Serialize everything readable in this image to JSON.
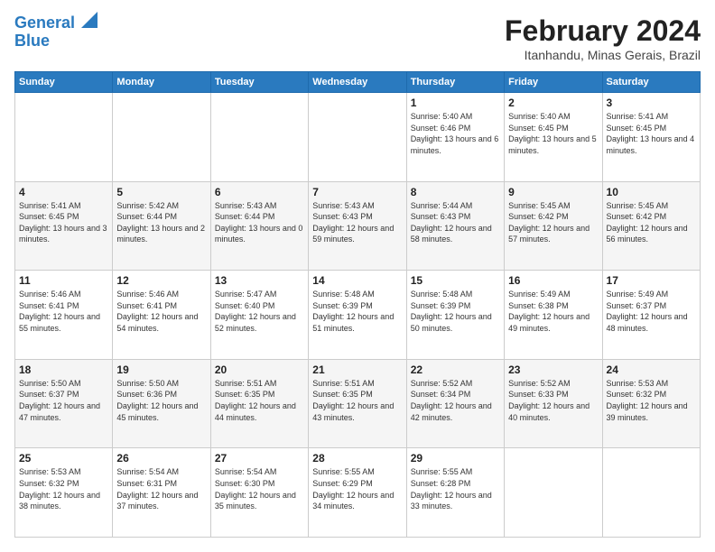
{
  "header": {
    "logo_line1": "General",
    "logo_line2": "Blue",
    "title": "February 2024",
    "location": "Itanhandu, Minas Gerais, Brazil"
  },
  "weekdays": [
    "Sunday",
    "Monday",
    "Tuesday",
    "Wednesday",
    "Thursday",
    "Friday",
    "Saturday"
  ],
  "weeks": [
    [
      {
        "day": "",
        "detail": ""
      },
      {
        "day": "",
        "detail": ""
      },
      {
        "day": "",
        "detail": ""
      },
      {
        "day": "",
        "detail": ""
      },
      {
        "day": "1",
        "detail": "Sunrise: 5:40 AM\nSunset: 6:46 PM\nDaylight: 13 hours\nand 6 minutes."
      },
      {
        "day": "2",
        "detail": "Sunrise: 5:40 AM\nSunset: 6:45 PM\nDaylight: 13 hours\nand 5 minutes."
      },
      {
        "day": "3",
        "detail": "Sunrise: 5:41 AM\nSunset: 6:45 PM\nDaylight: 13 hours\nand 4 minutes."
      }
    ],
    [
      {
        "day": "4",
        "detail": "Sunrise: 5:41 AM\nSunset: 6:45 PM\nDaylight: 13 hours\nand 3 minutes."
      },
      {
        "day": "5",
        "detail": "Sunrise: 5:42 AM\nSunset: 6:44 PM\nDaylight: 13 hours\nand 2 minutes."
      },
      {
        "day": "6",
        "detail": "Sunrise: 5:43 AM\nSunset: 6:44 PM\nDaylight: 13 hours\nand 0 minutes."
      },
      {
        "day": "7",
        "detail": "Sunrise: 5:43 AM\nSunset: 6:43 PM\nDaylight: 12 hours\nand 59 minutes."
      },
      {
        "day": "8",
        "detail": "Sunrise: 5:44 AM\nSunset: 6:43 PM\nDaylight: 12 hours\nand 58 minutes."
      },
      {
        "day": "9",
        "detail": "Sunrise: 5:45 AM\nSunset: 6:42 PM\nDaylight: 12 hours\nand 57 minutes."
      },
      {
        "day": "10",
        "detail": "Sunrise: 5:45 AM\nSunset: 6:42 PM\nDaylight: 12 hours\nand 56 minutes."
      }
    ],
    [
      {
        "day": "11",
        "detail": "Sunrise: 5:46 AM\nSunset: 6:41 PM\nDaylight: 12 hours\nand 55 minutes."
      },
      {
        "day": "12",
        "detail": "Sunrise: 5:46 AM\nSunset: 6:41 PM\nDaylight: 12 hours\nand 54 minutes."
      },
      {
        "day": "13",
        "detail": "Sunrise: 5:47 AM\nSunset: 6:40 PM\nDaylight: 12 hours\nand 52 minutes."
      },
      {
        "day": "14",
        "detail": "Sunrise: 5:48 AM\nSunset: 6:39 PM\nDaylight: 12 hours\nand 51 minutes."
      },
      {
        "day": "15",
        "detail": "Sunrise: 5:48 AM\nSunset: 6:39 PM\nDaylight: 12 hours\nand 50 minutes."
      },
      {
        "day": "16",
        "detail": "Sunrise: 5:49 AM\nSunset: 6:38 PM\nDaylight: 12 hours\nand 49 minutes."
      },
      {
        "day": "17",
        "detail": "Sunrise: 5:49 AM\nSunset: 6:37 PM\nDaylight: 12 hours\nand 48 minutes."
      }
    ],
    [
      {
        "day": "18",
        "detail": "Sunrise: 5:50 AM\nSunset: 6:37 PM\nDaylight: 12 hours\nand 47 minutes."
      },
      {
        "day": "19",
        "detail": "Sunrise: 5:50 AM\nSunset: 6:36 PM\nDaylight: 12 hours\nand 45 minutes."
      },
      {
        "day": "20",
        "detail": "Sunrise: 5:51 AM\nSunset: 6:35 PM\nDaylight: 12 hours\nand 44 minutes."
      },
      {
        "day": "21",
        "detail": "Sunrise: 5:51 AM\nSunset: 6:35 PM\nDaylight: 12 hours\nand 43 minutes."
      },
      {
        "day": "22",
        "detail": "Sunrise: 5:52 AM\nSunset: 6:34 PM\nDaylight: 12 hours\nand 42 minutes."
      },
      {
        "day": "23",
        "detail": "Sunrise: 5:52 AM\nSunset: 6:33 PM\nDaylight: 12 hours\nand 40 minutes."
      },
      {
        "day": "24",
        "detail": "Sunrise: 5:53 AM\nSunset: 6:32 PM\nDaylight: 12 hours\nand 39 minutes."
      }
    ],
    [
      {
        "day": "25",
        "detail": "Sunrise: 5:53 AM\nSunset: 6:32 PM\nDaylight: 12 hours\nand 38 minutes."
      },
      {
        "day": "26",
        "detail": "Sunrise: 5:54 AM\nSunset: 6:31 PM\nDaylight: 12 hours\nand 37 minutes."
      },
      {
        "day": "27",
        "detail": "Sunrise: 5:54 AM\nSunset: 6:30 PM\nDaylight: 12 hours\nand 35 minutes."
      },
      {
        "day": "28",
        "detail": "Sunrise: 5:55 AM\nSunset: 6:29 PM\nDaylight: 12 hours\nand 34 minutes."
      },
      {
        "day": "29",
        "detail": "Sunrise: 5:55 AM\nSunset: 6:28 PM\nDaylight: 12 hours\nand 33 minutes."
      },
      {
        "day": "",
        "detail": ""
      },
      {
        "day": "",
        "detail": ""
      }
    ]
  ]
}
